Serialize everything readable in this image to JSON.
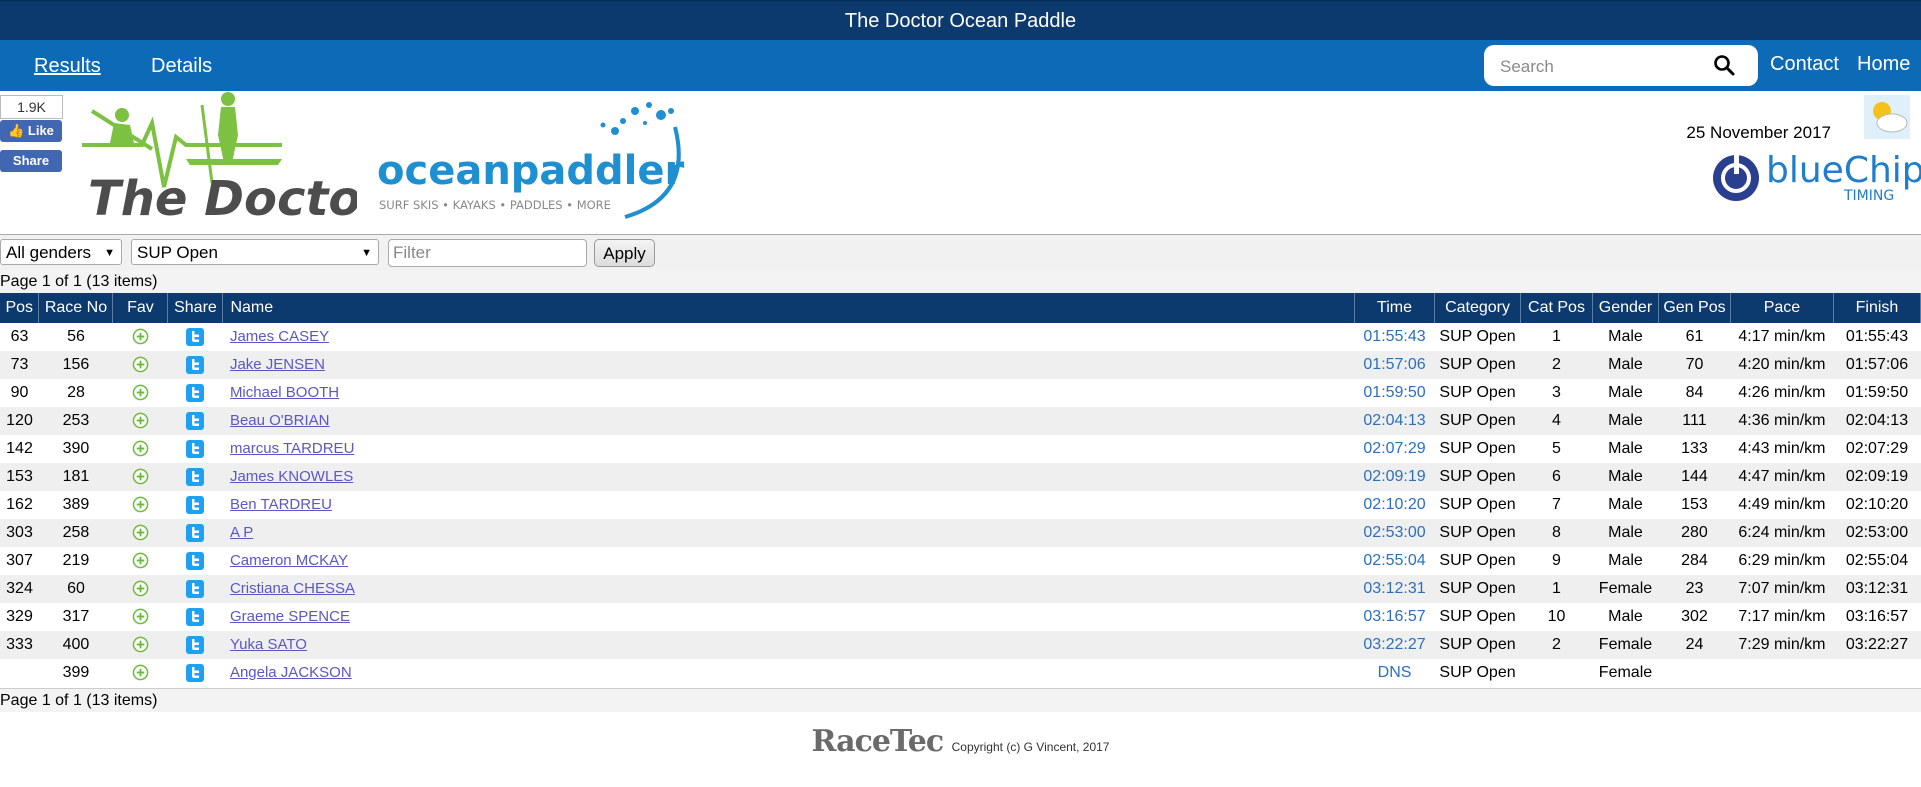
{
  "page_title": "The Doctor Ocean Paddle",
  "nav": {
    "results": "Results",
    "details": "Details",
    "search_placeholder": "Search",
    "contact": "Contact",
    "home": "Home"
  },
  "social": {
    "like_count": "1.9K",
    "like_label": "Like",
    "share_label": "Share"
  },
  "brand": {
    "doctor_logo_text": "The Doctor",
    "ocean_logo_text": "oceanpaddler",
    "ocean_tagline": "SURF SKIS • KAYAKS • PADDLES • MORE",
    "bluechip_text": "blueChip",
    "bluechip_sub": "TIMING"
  },
  "event_date": "25 November 2017",
  "filters": {
    "gender": "All genders",
    "category": "SUP Open",
    "filter_placeholder": "Filter",
    "apply": "Apply"
  },
  "pager_text": "Page 1 of 1 (13 items)",
  "columns": {
    "pos": "Pos",
    "race_no": "Race No",
    "fav": "Fav",
    "share": "Share",
    "name": "Name",
    "time": "Time",
    "category": "Category",
    "cat_pos": "Cat Pos",
    "gender": "Gender",
    "gen_pos": "Gen Pos",
    "pace": "Pace",
    "finish": "Finish"
  },
  "rows": [
    {
      "pos": "63",
      "race_no": "56",
      "name": "James CASEY",
      "time": "01:55:43",
      "category": "SUP Open",
      "cat_pos": "1",
      "gender": "Male",
      "gen_pos": "61",
      "pace": "4:17 min/km",
      "finish": "01:55:43"
    },
    {
      "pos": "73",
      "race_no": "156",
      "name": "Jake JENSEN",
      "time": "01:57:06",
      "category": "SUP Open",
      "cat_pos": "2",
      "gender": "Male",
      "gen_pos": "70",
      "pace": "4:20 min/km",
      "finish": "01:57:06"
    },
    {
      "pos": "90",
      "race_no": "28",
      "name": "Michael BOOTH",
      "time": "01:59:50",
      "category": "SUP Open",
      "cat_pos": "3",
      "gender": "Male",
      "gen_pos": "84",
      "pace": "4:26 min/km",
      "finish": "01:59:50"
    },
    {
      "pos": "120",
      "race_no": "253",
      "name": "Beau O'BRIAN",
      "time": "02:04:13",
      "category": "SUP Open",
      "cat_pos": "4",
      "gender": "Male",
      "gen_pos": "111",
      "pace": "4:36 min/km",
      "finish": "02:04:13"
    },
    {
      "pos": "142",
      "race_no": "390",
      "name": "marcus TARDREU",
      "time": "02:07:29",
      "category": "SUP Open",
      "cat_pos": "5",
      "gender": "Male",
      "gen_pos": "133",
      "pace": "4:43 min/km",
      "finish": "02:07:29"
    },
    {
      "pos": "153",
      "race_no": "181",
      "name": "James KNOWLES",
      "time": "02:09:19",
      "category": "SUP Open",
      "cat_pos": "6",
      "gender": "Male",
      "gen_pos": "144",
      "pace": "4:47 min/km",
      "finish": "02:09:19"
    },
    {
      "pos": "162",
      "race_no": "389",
      "name": "Ben TARDREU",
      "time": "02:10:20",
      "category": "SUP Open",
      "cat_pos": "7",
      "gender": "Male",
      "gen_pos": "153",
      "pace": "4:49 min/km",
      "finish": "02:10:20"
    },
    {
      "pos": "303",
      "race_no": "258",
      "name": "A P",
      "time": "02:53:00",
      "category": "SUP Open",
      "cat_pos": "8",
      "gender": "Male",
      "gen_pos": "280",
      "pace": "6:24 min/km",
      "finish": "02:53:00"
    },
    {
      "pos": "307",
      "race_no": "219",
      "name": "Cameron MCKAY",
      "time": "02:55:04",
      "category": "SUP Open",
      "cat_pos": "9",
      "gender": "Male",
      "gen_pos": "284",
      "pace": "6:29 min/km",
      "finish": "02:55:04"
    },
    {
      "pos": "324",
      "race_no": "60",
      "name": "Cristiana CHESSA",
      "time": "03:12:31",
      "category": "SUP Open",
      "cat_pos": "1",
      "gender": "Female",
      "gen_pos": "23",
      "pace": "7:07 min/km",
      "finish": "03:12:31"
    },
    {
      "pos": "329",
      "race_no": "317",
      "name": "Graeme SPENCE",
      "time": "03:16:57",
      "category": "SUP Open",
      "cat_pos": "10",
      "gender": "Male",
      "gen_pos": "302",
      "pace": "7:17 min/km",
      "finish": "03:16:57"
    },
    {
      "pos": "333",
      "race_no": "400",
      "name": "Yuka SATO",
      "time": "03:22:27",
      "category": "SUP Open",
      "cat_pos": "2",
      "gender": "Female",
      "gen_pos": "24",
      "pace": "7:29 min/km",
      "finish": "03:22:27"
    },
    {
      "pos": "",
      "race_no": "399",
      "name": "Angela JACKSON",
      "time": "DNS",
      "category": "SUP Open",
      "cat_pos": "",
      "gender": "Female",
      "gen_pos": "",
      "pace": "",
      "finish": ""
    }
  ],
  "footer": {
    "racetec": "RaceTec",
    "copyright": "Copyright (c) G Vincent, 2017"
  },
  "icons": {
    "search": "search-icon",
    "fav": "plus-circle-icon",
    "share": "twitter-icon",
    "weather": "partly-cloudy-icon",
    "like": "thumbs-up-icon"
  },
  "colors": {
    "title_bar": "#0c3a6e",
    "nav_bar": "#0d6ab6",
    "table_header": "#0c3a6e",
    "link": "#5a57c8",
    "time": "#2a6fc0",
    "facebook": "#4267b2",
    "fav_green": "#6cbb3c",
    "twitter_blue": "#1da1f2"
  }
}
